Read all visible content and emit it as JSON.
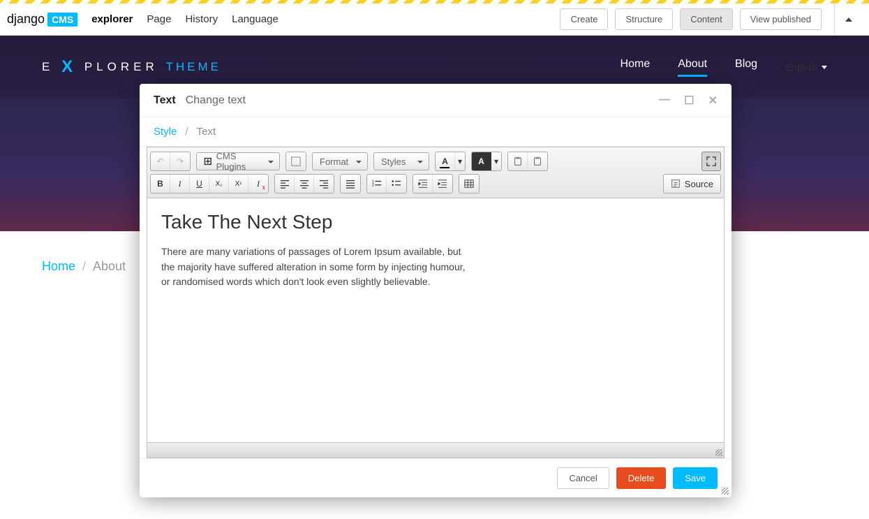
{
  "admin": {
    "logo_left": "django",
    "logo_right": "CMS",
    "links": [
      "explorer",
      "Page",
      "History",
      "Language"
    ],
    "active_link_index": 0,
    "buttons": {
      "create": "Create",
      "structure": "Structure",
      "content": "Content",
      "view_published": "View published"
    }
  },
  "site": {
    "brand_left": "E",
    "brand_x": "X",
    "brand_mid": "PLORER",
    "brand_theme": "THEME",
    "nav": [
      "Home",
      "About",
      "Blog"
    ],
    "active_nav_index": 1,
    "language": "English"
  },
  "breadcrumb": {
    "home": "Home",
    "current": "About"
  },
  "modal": {
    "title_bold": "Text",
    "title_sub": "Change text",
    "crumb_style": "Style",
    "crumb_text": "Text",
    "toolbar": {
      "cms_plugins": "CMS Plugins",
      "format": "Format",
      "styles": "Styles",
      "source": "Source",
      "text_color_letter": "A",
      "bg_color_letter": "A"
    },
    "content": {
      "heading": "Take The Next Step",
      "paragraph": "There are many variations of passages of Lorem Ipsum available, but the majority have suffered alteration in some form by injecting humour, or randomised words which don't look even slightly believable."
    },
    "footer": {
      "cancel": "Cancel",
      "delete": "Delete",
      "save": "Save"
    }
  }
}
